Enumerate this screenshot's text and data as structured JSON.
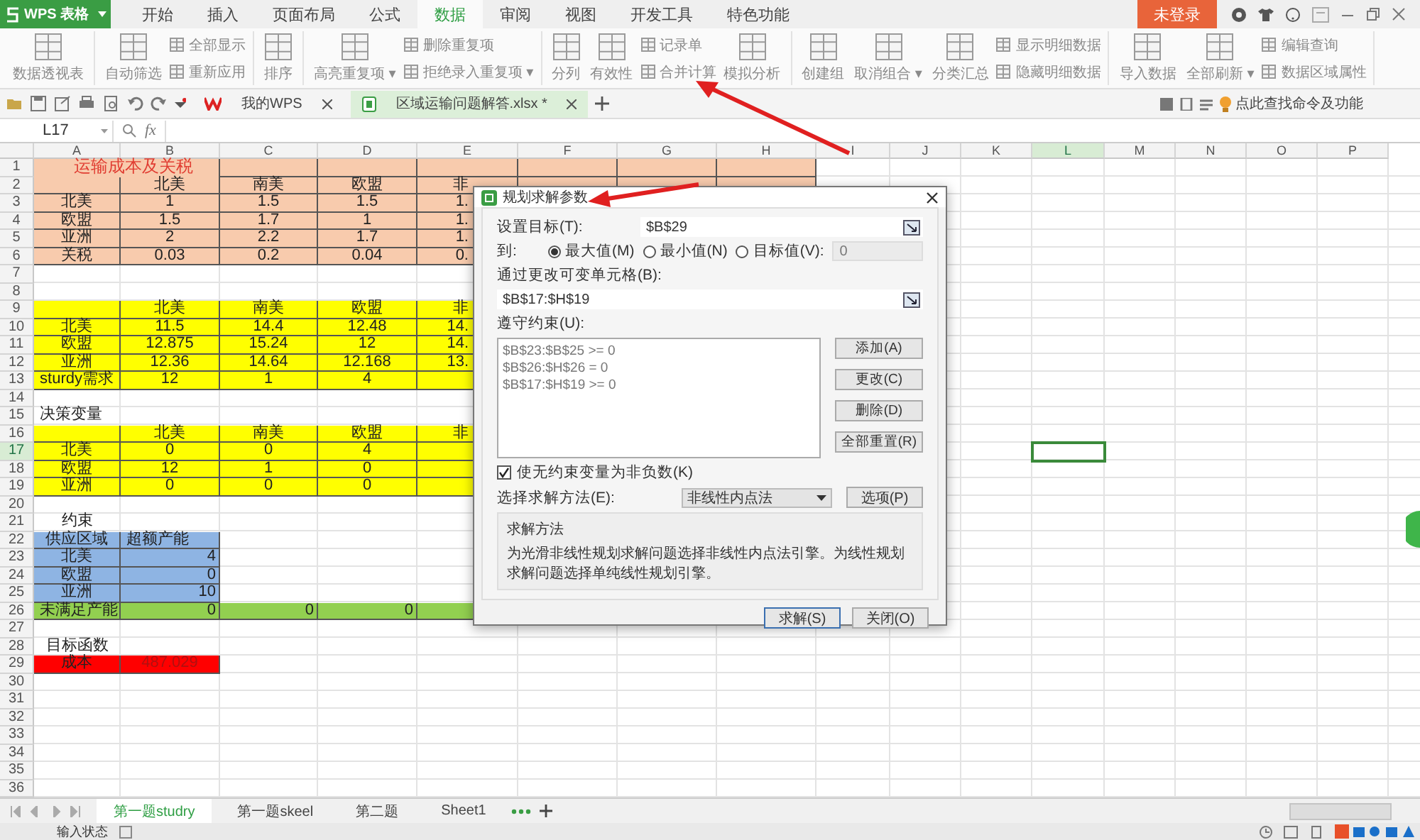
{
  "app_menu": {
    "label": "WPS 表格"
  },
  "menu_tabs": [
    {
      "label": "开始",
      "selected": false
    },
    {
      "label": "插入",
      "selected": false
    },
    {
      "label": "页面布局",
      "selected": false
    },
    {
      "label": "公式",
      "selected": false
    },
    {
      "label": "数据",
      "selected": true
    },
    {
      "label": "审阅",
      "selected": false
    },
    {
      "label": "视图",
      "selected": false
    },
    {
      "label": "开发工具",
      "selected": false
    },
    {
      "label": "特色功能",
      "selected": false
    }
  ],
  "login_button": "未登录",
  "ribbon_groups": [
    {
      "items": [
        {
          "kind": "large",
          "label": "数据透视表"
        }
      ]
    },
    {
      "items": [
        {
          "kind": "large",
          "label": "自动筛选"
        },
        {
          "kind": "small",
          "label": "全部显示"
        },
        {
          "kind": "small",
          "label": "重新应用"
        }
      ]
    },
    {
      "items": [
        {
          "kind": "large",
          "label": "排序"
        }
      ]
    },
    {
      "items": [
        {
          "kind": "large",
          "label": "高亮重复项",
          "caret": "▾"
        },
        {
          "kind": "small",
          "label": "删除重复项"
        },
        {
          "kind": "small",
          "label": "拒绝录入重复项",
          "caret": "▾"
        }
      ]
    },
    {
      "items": [
        {
          "kind": "large",
          "label": "分列"
        },
        {
          "kind": "large",
          "label": "有效性"
        },
        {
          "kind": "small",
          "label": "记录单"
        },
        {
          "kind": "small",
          "label": "合并计算"
        },
        {
          "kind": "large",
          "label": "模拟分析"
        }
      ]
    },
    {
      "items": [
        {
          "kind": "large",
          "label": "创建组"
        },
        {
          "kind": "large",
          "label": "取消组合",
          "caret": "▾"
        },
        {
          "kind": "large",
          "label": "分类汇总"
        },
        {
          "kind": "small",
          "label": "显示明细数据"
        },
        {
          "kind": "small",
          "label": "隐藏明细数据"
        }
      ]
    },
    {
      "items": [
        {
          "kind": "large",
          "label": "导入数据"
        },
        {
          "kind": "large",
          "label": "全部刷新",
          "caret": "▾"
        },
        {
          "kind": "small",
          "label": "编辑查询"
        },
        {
          "kind": "small",
          "label": "数据区域属性"
        }
      ]
    }
  ],
  "doc_tabs": [
    {
      "label": "我的WPS",
      "selected": false
    },
    {
      "label": "区域运输问题解答.xlsx *",
      "selected": true
    }
  ],
  "command_search": {
    "placeholder": "点此查找命令及功能"
  },
  "formula_bar": {
    "name_box": "L17",
    "function_label": "fx"
  },
  "columns": [
    {
      "label": "A",
      "selected": false
    },
    {
      "label": "B",
      "selected": false
    },
    {
      "label": "C",
      "selected": false
    },
    {
      "label": "D",
      "selected": false
    },
    {
      "label": "E",
      "selected": false
    },
    {
      "label": "F",
      "selected": false
    },
    {
      "label": "G",
      "selected": false
    },
    {
      "label": "H",
      "selected": false
    },
    {
      "label": "I",
      "selected": false
    },
    {
      "label": "J",
      "selected": false
    },
    {
      "label": "K",
      "selected": false
    },
    {
      "label": "L",
      "selected": true
    },
    {
      "label": "M",
      "selected": false
    },
    {
      "label": "N",
      "selected": false
    },
    {
      "label": "O",
      "selected": false
    },
    {
      "label": "P",
      "selected": false
    }
  ],
  "rows": [
    {
      "number": "1",
      "selected": false,
      "cells": [
        {
          "text": "运输成本及关税",
          "color": "#f8cbad",
          "kind": "title"
        },
        {
          "color": "#f8cbad"
        },
        {
          "color": "#f8cbad"
        },
        {
          "color": "#f8cbad"
        },
        {
          "color": "#f8cbad"
        },
        {
          "color": "#f8cbad"
        },
        {
          "color": "#f8cbad"
        }
      ]
    },
    {
      "number": "2",
      "selected": false,
      "cells": [
        {
          "color": "#f8cbad"
        },
        {
          "text": "北美",
          "color": "#f8cbad"
        },
        {
          "text": "南美",
          "color": "#f8cbad"
        },
        {
          "text": "欧盟",
          "color": "#f8cbad"
        },
        {
          "text": "非",
          "color": "#f8cbad"
        },
        {
          "color": "#f8cbad"
        },
        {
          "color": "#f8cbad"
        },
        {
          "color": "#f8cbad"
        }
      ]
    },
    {
      "number": "3",
      "selected": false,
      "cells": [
        {
          "text": "北美",
          "color": "#f8cbad"
        },
        {
          "text": "1",
          "color": "#f8cbad"
        },
        {
          "text": "1.5",
          "color": "#f8cbad"
        },
        {
          "text": "1.5",
          "color": "#f8cbad"
        },
        {
          "text": "1.",
          "color": "#f8cbad"
        }
      ]
    },
    {
      "number": "4",
      "selected": false,
      "cells": [
        {
          "text": "欧盟",
          "color": "#f8cbad"
        },
        {
          "text": "1.5",
          "color": "#f8cbad"
        },
        {
          "text": "1.7",
          "color": "#f8cbad"
        },
        {
          "text": "1",
          "color": "#f8cbad"
        },
        {
          "text": "1.",
          "color": "#f8cbad"
        }
      ]
    },
    {
      "number": "5",
      "selected": false,
      "cells": [
        {
          "text": "亚洲",
          "color": "#f8cbad"
        },
        {
          "text": "2",
          "color": "#f8cbad"
        },
        {
          "text": "2.2",
          "color": "#f8cbad"
        },
        {
          "text": "1.7",
          "color": "#f8cbad"
        },
        {
          "text": "1.",
          "color": "#f8cbad"
        }
      ]
    },
    {
      "number": "6",
      "selected": false,
      "cells": [
        {
          "text": "关税",
          "color": "#f8cbad"
        },
        {
          "text": "0.03",
          "color": "#f8cbad"
        },
        {
          "text": "0.2",
          "color": "#f8cbad"
        },
        {
          "text": "0.04",
          "color": "#f8cbad"
        },
        {
          "text": "0.",
          "color": "#f8cbad"
        }
      ]
    },
    {
      "number": "7",
      "selected": false,
      "cells": []
    },
    {
      "number": "8",
      "selected": false,
      "cells": []
    },
    {
      "number": "9",
      "selected": false,
      "cells": [
        {
          "color": "#ffff00"
        },
        {
          "text": "北美",
          "color": "#ffff00"
        },
        {
          "text": "南美",
          "color": "#ffff00"
        },
        {
          "text": "欧盟",
          "color": "#ffff00"
        },
        {
          "text": "非",
          "color": "#ffff00"
        }
      ]
    },
    {
      "number": "10",
      "selected": false,
      "cells": [
        {
          "text": "北美",
          "color": "#ffff00"
        },
        {
          "text": "11.5",
          "color": "#ffff00"
        },
        {
          "text": "14.4",
          "color": "#ffff00"
        },
        {
          "text": "12.48",
          "color": "#ffff00"
        },
        {
          "text": "14.",
          "color": "#ffff00"
        }
      ]
    },
    {
      "number": "11",
      "selected": false,
      "cells": [
        {
          "text": "欧盟",
          "color": "#ffff00"
        },
        {
          "text": "12.875",
          "color": "#ffff00"
        },
        {
          "text": "15.24",
          "color": "#ffff00"
        },
        {
          "text": "12",
          "color": "#ffff00"
        },
        {
          "text": "14.",
          "color": "#ffff00"
        }
      ]
    },
    {
      "number": "12",
      "selected": false,
      "cells": [
        {
          "text": "亚洲",
          "color": "#ffff00"
        },
        {
          "text": "12.36",
          "color": "#ffff00"
        },
        {
          "text": "14.64",
          "color": "#ffff00"
        },
        {
          "text": "12.168",
          "color": "#ffff00"
        },
        {
          "text": "13.",
          "color": "#ffff00"
        }
      ]
    },
    {
      "number": "13",
      "selected": false,
      "cells": [
        {
          "text": "sturdy需求",
          "color": "#ffff00"
        },
        {
          "text": "12",
          "color": "#ffff00"
        },
        {
          "text": "1",
          "color": "#ffff00"
        },
        {
          "text": "4",
          "color": "#ffff00"
        },
        {
          "color": "#ffff00"
        }
      ]
    },
    {
      "number": "14",
      "selected": false,
      "cells": []
    },
    {
      "number": "15",
      "selected": false,
      "cells": [
        {
          "text": "决策变量",
          "kind": "left"
        }
      ]
    },
    {
      "number": "16",
      "selected": false,
      "cells": [
        {
          "color": "#ffff00"
        },
        {
          "text": "北美",
          "color": "#ffff00"
        },
        {
          "text": "南美",
          "color": "#ffff00"
        },
        {
          "text": "欧盟",
          "color": "#ffff00"
        },
        {
          "text": "非",
          "color": "#ffff00"
        }
      ]
    },
    {
      "number": "17",
      "selected": true,
      "cells": [
        {
          "text": "北美",
          "color": "#ffff00"
        },
        {
          "text": "0",
          "color": "#ffff00"
        },
        {
          "text": "0",
          "color": "#ffff00"
        },
        {
          "text": "4",
          "color": "#ffff00"
        },
        {
          "color": "#ffff00"
        }
      ]
    },
    {
      "number": "18",
      "selected": false,
      "cells": [
        {
          "text": "欧盟",
          "color": "#ffff00"
        },
        {
          "text": "12",
          "color": "#ffff00"
        },
        {
          "text": "1",
          "color": "#ffff00"
        },
        {
          "text": "0",
          "color": "#ffff00"
        },
        {
          "color": "#ffff00"
        }
      ]
    },
    {
      "number": "19",
      "selected": false,
      "cells": [
        {
          "text": "亚洲",
          "color": "#ffff00"
        },
        {
          "text": "0",
          "color": "#ffff00"
        },
        {
          "text": "0",
          "color": "#ffff00"
        },
        {
          "text": "0",
          "color": "#ffff00"
        },
        {
          "color": "#ffff00"
        }
      ]
    },
    {
      "number": "20",
      "selected": false,
      "cells": []
    },
    {
      "number": "21",
      "selected": false,
      "cells": [
        {
          "text": "约束"
        }
      ]
    },
    {
      "number": "22",
      "selected": false,
      "cells": [
        {
          "text": "供应区域",
          "color": "#8eb4e3"
        },
        {
          "text": "超额产能",
          "color": "#8eb4e3",
          "kind": "left"
        }
      ]
    },
    {
      "number": "23",
      "selected": false,
      "cells": [
        {
          "text": "北美",
          "color": "#8eb4e3"
        },
        {
          "text": "4",
          "color": "#8eb4e3",
          "kind": "right"
        }
      ]
    },
    {
      "number": "24",
      "selected": false,
      "cells": [
        {
          "text": "欧盟",
          "color": "#8eb4e3"
        },
        {
          "text": "0",
          "color": "#8eb4e3",
          "kind": "right"
        }
      ]
    },
    {
      "number": "25",
      "selected": false,
      "cells": [
        {
          "text": "亚洲",
          "color": "#8eb4e3"
        },
        {
          "text": "10",
          "color": "#8eb4e3",
          "kind": "right"
        }
      ]
    },
    {
      "number": "26",
      "selected": false,
      "cells": [
        {
          "text": "未满足产能",
          "color": "#92d050",
          "kind": "left"
        },
        {
          "text": "0",
          "color": "#92d050",
          "kind": "right"
        },
        {
          "text": "0",
          "color": "#92d050",
          "kind": "right"
        },
        {
          "text": "0",
          "color": "#92d050",
          "kind": "right"
        },
        {
          "color": "#92d050"
        }
      ]
    },
    {
      "number": "27",
      "selected": false,
      "cells": []
    },
    {
      "number": "28",
      "selected": false,
      "cells": [
        {
          "text": "目标函数"
        }
      ]
    },
    {
      "number": "29",
      "selected": false,
      "cells": [
        {
          "text": "成本",
          "color": "#ff0000"
        },
        {
          "text": "487.029",
          "color": "#ff0000",
          "kind": "dim"
        }
      ]
    },
    {
      "number": "30",
      "selected": false,
      "cells": []
    },
    {
      "number": "31",
      "selected": false,
      "cells": []
    },
    {
      "number": "32",
      "selected": false,
      "cells": []
    },
    {
      "number": "33",
      "selected": false,
      "cells": []
    },
    {
      "number": "34",
      "selected": false,
      "cells": []
    },
    {
      "number": "35",
      "selected": false,
      "cells": []
    },
    {
      "number": "36",
      "selected": false,
      "cells": []
    }
  ],
  "dialog": {
    "title": "规划求解参数",
    "target": {
      "label": "设置目标(T):",
      "value": "$B$29"
    },
    "to": {
      "label": "到:",
      "options": [
        {
          "label": "最大值(M)",
          "selected": true
        },
        {
          "label": "最小值(N)",
          "selected": false
        },
        {
          "label": "目标值(V):",
          "selected": false
        }
      ],
      "value_field": {
        "value": "0",
        "disabled": true
      }
    },
    "changing_cells": {
      "label": "通过更改可变单元格(B):",
      "value": "$B$17:$H$19"
    },
    "constraints": {
      "label": "遵守约束(U):",
      "items": [
        "$B$23:$B$25 >= 0",
        "$B$26:$H$26 = 0",
        "$B$17:$H$19 >= 0"
      ]
    },
    "constraint_buttons": [
      "添加(A)",
      "更改(C)",
      "删除(D)",
      "全部重置(R)"
    ],
    "nonnegative": {
      "label": "使无约束变量为非负数(K)",
      "checked": true
    },
    "method": {
      "label": "选择求解方法(E):",
      "value": "非线性内点法",
      "options_button": "选项(P)"
    },
    "method_info": {
      "title": "求解方法",
      "text": "为光滑非线性规划求解问题选择非线性内点法引擎。为线性规划求解问题选择单纯线性规划引擎。"
    },
    "buttons": [
      {
        "label": "求解(S)",
        "default": true
      },
      {
        "label": "关闭(O)",
        "default": false
      }
    ]
  },
  "sheet_tabs": [
    {
      "label": "第一题studry",
      "selected": true
    },
    {
      "label": "第一题skeel",
      "selected": false
    },
    {
      "label": "第二题",
      "selected": false
    },
    {
      "label": "Sheet1",
      "selected": false
    }
  ],
  "status_bar": {
    "mode": "输入状态"
  }
}
